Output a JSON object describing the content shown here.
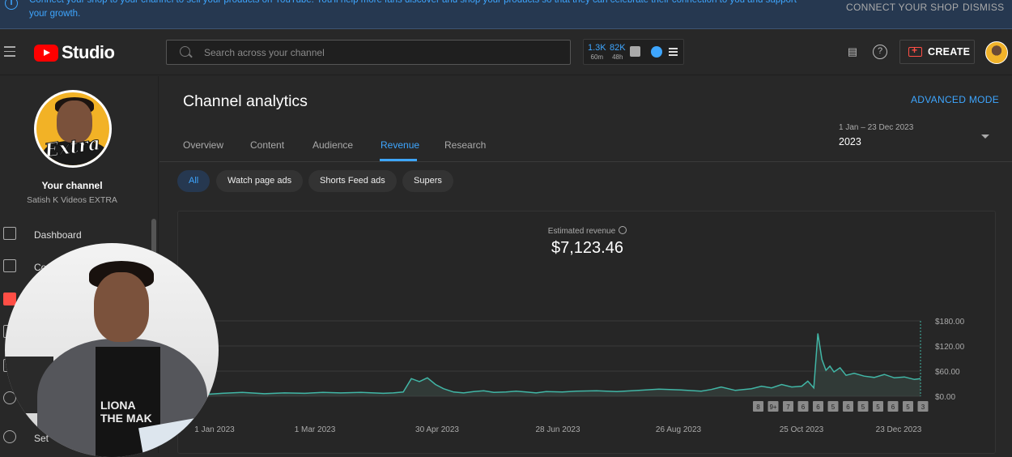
{
  "banner": {
    "text": "Connect your shop to your channel to sell your products on YouTube. You'll help more fans discover and shop your products so that they can celebrate their connection to you and support your growth.",
    "connect_label": "CONNECT YOUR SHOP",
    "dismiss_label": "DISMISS"
  },
  "header": {
    "brand": "Studio",
    "search_placeholder": "Search across your channel",
    "stats": [
      {
        "value": "1.3K",
        "label": "60m"
      },
      {
        "value": "82K",
        "label": "48h"
      }
    ],
    "create_label": "CREATE"
  },
  "sidebar": {
    "channel_title": "Your channel",
    "channel_name": "Satish K Videos EXTRA",
    "avatar_text": "Extra",
    "items": [
      {
        "label": "Dashboard",
        "icon": "dashboard-icon"
      },
      {
        "label": "Co",
        "icon": "content-icon"
      },
      {
        "label": "",
        "icon": "analytics-icon"
      },
      {
        "label": "",
        "icon": "comments-icon"
      },
      {
        "label": "",
        "icon": "subtitles-icon"
      },
      {
        "label": "",
        "icon": "copyright-icon"
      },
      {
        "label": "Set",
        "icon": "settings-icon"
      }
    ]
  },
  "webcam": {
    "shirt_text_1": "LIONA",
    "shirt_text_2": "THE MAK"
  },
  "main": {
    "title": "Channel analytics",
    "advanced_mode": "ADVANCED MODE",
    "tabs": [
      "Overview",
      "Content",
      "Audience",
      "Revenue",
      "Research"
    ],
    "active_tab": "Revenue",
    "date_range_label": "1 Jan – 23 Dec 2023",
    "date_range_value": "2023",
    "chips": [
      "All",
      "Watch page ads",
      "Shorts Feed ads",
      "Supers"
    ],
    "metric_label": "Estimated revenue",
    "metric_value": "$7,123.46"
  },
  "colors": {
    "accent": "#3ea6ff",
    "line": "#41b6a6",
    "brand_red": "#ff0000"
  },
  "chart_data": {
    "type": "area",
    "x_ticks": [
      "1 Jan 2023",
      "1 Mar 2023",
      "30 Apr 2023",
      "28 Jun 2023",
      "26 Aug 2023",
      "25 Oct 2023",
      "23 Dec 2023"
    ],
    "y_ticks": [
      "$0.00",
      "$60.00",
      "$120.00",
      "$180.00"
    ],
    "ylim": [
      0,
      180
    ],
    "markers": [
      "8",
      "9+",
      "7",
      "6",
      "6",
      "5",
      "6",
      "5",
      "5",
      "6",
      "5",
      "3"
    ],
    "x": [
      "2023-01-01",
      "2023-01-10",
      "2023-01-20",
      "2023-01-31",
      "2023-02-10",
      "2023-02-20",
      "2023-03-01",
      "2023-03-10",
      "2023-03-20",
      "2023-03-31",
      "2023-04-05",
      "2023-04-10",
      "2023-04-14",
      "2023-04-18",
      "2023-04-22",
      "2023-04-26",
      "2023-04-30",
      "2023-05-05",
      "2023-05-10",
      "2023-05-15",
      "2023-05-20",
      "2023-05-25",
      "2023-05-31",
      "2023-06-05",
      "2023-06-10",
      "2023-06-15",
      "2023-06-20",
      "2023-06-28",
      "2023-07-05",
      "2023-07-15",
      "2023-07-25",
      "2023-08-05",
      "2023-08-15",
      "2023-08-26",
      "2023-09-05",
      "2023-09-10",
      "2023-09-15",
      "2023-09-22",
      "2023-09-30",
      "2023-10-05",
      "2023-10-10",
      "2023-10-15",
      "2023-10-20",
      "2023-10-25",
      "2023-10-28",
      "2023-10-31",
      "2023-11-02",
      "2023-11-04",
      "2023-11-06",
      "2023-11-08",
      "2023-11-10",
      "2023-11-13",
      "2023-11-16",
      "2023-11-20",
      "2023-11-25",
      "2023-11-30",
      "2023-12-05",
      "2023-12-10",
      "2023-12-15",
      "2023-12-20",
      "2023-12-23"
    ],
    "y": [
      4,
      7,
      9,
      6,
      8,
      7,
      9,
      8,
      9,
      7,
      8,
      10,
      42,
      35,
      44,
      28,
      18,
      10,
      8,
      11,
      13,
      9,
      10,
      12,
      10,
      8,
      11,
      10,
      12,
      13,
      11,
      14,
      17,
      15,
      12,
      16,
      22,
      14,
      18,
      24,
      20,
      28,
      22,
      24,
      36,
      20,
      150,
      88,
      62,
      72,
      58,
      68,
      50,
      55,
      48,
      45,
      52,
      44,
      46,
      40,
      42
    ],
    "xlabel": "",
    "ylabel": "",
    "grid": true
  }
}
